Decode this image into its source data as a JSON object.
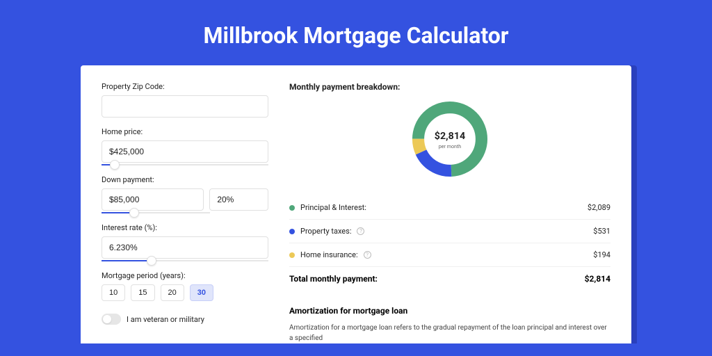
{
  "title": "Millbrook Mortgage Calculator",
  "form": {
    "zip": {
      "label": "Property Zip Code:",
      "value": ""
    },
    "home_price": {
      "label": "Home price:",
      "value": "$425,000",
      "slider_pct": 8
    },
    "down_payment": {
      "label": "Down payment:",
      "amount": "$85,000",
      "percent": "20%",
      "slider_pct": 20
    },
    "interest_rate": {
      "label": "Interest rate (%):",
      "value": "6.230%",
      "slider_pct": 30
    },
    "period": {
      "label": "Mortgage period (years):",
      "options": [
        "10",
        "15",
        "20",
        "30"
      ],
      "selected": "30"
    },
    "veteran": {
      "label": "I am veteran or military",
      "on": false
    }
  },
  "breakdown": {
    "title": "Monthly payment breakdown:",
    "center_amount": "$2,814",
    "center_sub": "per month",
    "items": [
      {
        "label": "Principal & Interest:",
        "value": "$2,089",
        "color": "#4fa77a"
      },
      {
        "label": "Property taxes:",
        "value": "$531",
        "color": "#3452e0",
        "info": true
      },
      {
        "label": "Home insurance:",
        "value": "$194",
        "color": "#ecc957",
        "info": true
      }
    ],
    "total_label": "Total monthly payment:",
    "total_value": "$2,814"
  },
  "amort": {
    "title": "Amortization for mortgage loan",
    "text": "Amortization for a mortgage loan refers to the gradual repayment of the loan principal and interest over a specified"
  },
  "chart_data": {
    "type": "pie",
    "title": "Monthly payment breakdown",
    "series": [
      {
        "name": "Principal & Interest",
        "value": 2089,
        "color": "#4fa77a"
      },
      {
        "name": "Property taxes",
        "value": 531,
        "color": "#3452e0"
      },
      {
        "name": "Home insurance",
        "value": 194,
        "color": "#ecc957"
      }
    ],
    "total": 2814,
    "center_label": "$2,814 per month"
  }
}
